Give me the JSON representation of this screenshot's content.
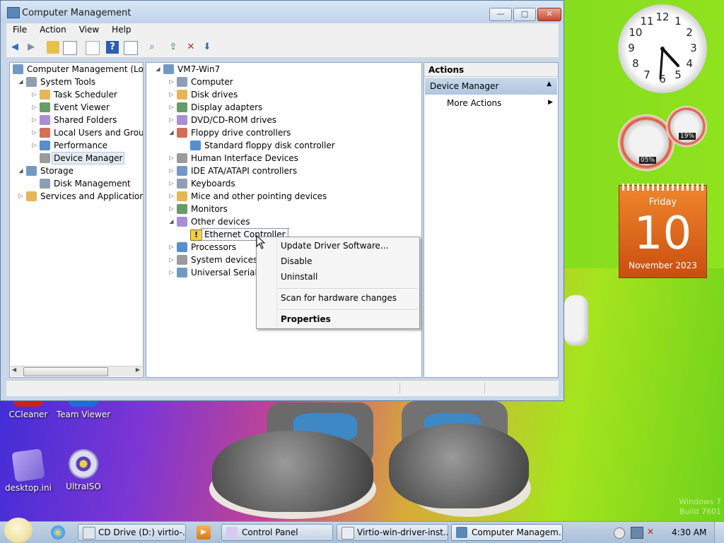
{
  "window": {
    "title": "Computer Management",
    "controls": {
      "minimize": "—",
      "maximize": "□",
      "close": "✕"
    },
    "menu": [
      "File",
      "Action",
      "View",
      "Help"
    ]
  },
  "left_tree": [
    {
      "label": "Computer Management (Local",
      "level": 0,
      "expander": "",
      "icon": "computer-management-icon"
    },
    {
      "label": "System Tools",
      "level": 1,
      "expander": "◢",
      "icon": "system-tools-icon"
    },
    {
      "label": "Task Scheduler",
      "level": 2,
      "expander": "▷",
      "icon": "clock-icon"
    },
    {
      "label": "Event Viewer",
      "level": 2,
      "expander": "▷",
      "icon": "event-viewer-icon"
    },
    {
      "label": "Shared Folders",
      "level": 2,
      "expander": "▷",
      "icon": "shared-folder-icon"
    },
    {
      "label": "Local Users and Groups",
      "level": 2,
      "expander": "▷",
      "icon": "users-icon"
    },
    {
      "label": "Performance",
      "level": 2,
      "expander": "▷",
      "icon": "performance-icon"
    },
    {
      "label": "Device Manager",
      "level": 2,
      "expander": "",
      "icon": "device-manager-icon",
      "selected": true
    },
    {
      "label": "Storage",
      "level": 1,
      "expander": "◢",
      "icon": "storage-icon"
    },
    {
      "label": "Disk Management",
      "level": 2,
      "expander": "",
      "icon": "disk-management-icon"
    },
    {
      "label": "Services and Applications",
      "level": 1,
      "expander": "▷",
      "icon": "services-icon"
    }
  ],
  "device_tree": [
    {
      "label": "VM7-Win7",
      "level": 0,
      "expander": "◢",
      "icon": "computer-icon"
    },
    {
      "label": "Computer",
      "level": 1,
      "expander": "▷",
      "icon": "computer-icon"
    },
    {
      "label": "Disk drives",
      "level": 1,
      "expander": "▷",
      "icon": "disk-drive-icon"
    },
    {
      "label": "Display adapters",
      "level": 1,
      "expander": "▷",
      "icon": "display-adapter-icon"
    },
    {
      "label": "DVD/CD-ROM drives",
      "level": 1,
      "expander": "▷",
      "icon": "dvd-drive-icon"
    },
    {
      "label": "Floppy drive controllers",
      "level": 1,
      "expander": "◢",
      "icon": "floppy-controller-icon"
    },
    {
      "label": "Standard floppy disk controller",
      "level": 2,
      "expander": "",
      "icon": "floppy-controller-icon"
    },
    {
      "label": "Human Interface Devices",
      "level": 1,
      "expander": "▷",
      "icon": "hid-icon"
    },
    {
      "label": "IDE ATA/ATAPI controllers",
      "level": 1,
      "expander": "▷",
      "icon": "ide-controller-icon"
    },
    {
      "label": "Keyboards",
      "level": 1,
      "expander": "▷",
      "icon": "keyboard-icon"
    },
    {
      "label": "Mice and other pointing devices",
      "level": 1,
      "expander": "▷",
      "icon": "mouse-icon"
    },
    {
      "label": "Monitors",
      "level": 1,
      "expander": "▷",
      "icon": "monitor-icon"
    },
    {
      "label": "Other devices",
      "level": 1,
      "expander": "◢",
      "icon": "unknown-device-icon"
    },
    {
      "label": "Ethernet Controller",
      "level": 2,
      "expander": "",
      "icon": "warning-device-icon",
      "focused": true
    },
    {
      "label": "Processors",
      "level": 1,
      "expander": "▷",
      "icon": "processor-icon"
    },
    {
      "label": "System devices",
      "level": 1,
      "expander": "▷",
      "icon": "system-device-icon"
    },
    {
      "label": "Universal Serial Bu",
      "level": 1,
      "expander": "▷",
      "icon": "usb-icon"
    }
  ],
  "actions": {
    "header": "Actions",
    "section": "Device Manager",
    "more": "More Actions"
  },
  "context_menu": {
    "update": "Update Driver Software...",
    "disable": "Disable",
    "uninstall": "Uninstall",
    "scan": "Scan for hardware changes",
    "properties": "Properties"
  },
  "gadgets": {
    "clock_numbers": [
      "12",
      "1",
      "2",
      "3",
      "4",
      "5",
      "6",
      "7",
      "8",
      "9",
      "10",
      "11"
    ],
    "cpu_meter": "05%",
    "memory_meter": "19%",
    "calendar_day": "Friday",
    "calendar_date": "10",
    "calendar_month_year": "November 2023"
  },
  "desktop_icons": {
    "ccleaner": "CCleaner",
    "teamviewer": "Team Viewer",
    "desktop_ini": "desktop.ini",
    "ultraiso": "UltraISO"
  },
  "watermark": {
    "line1": "Windows 7",
    "line2": "Build 7601"
  },
  "taskbar": {
    "tasks": [
      "CD Drive (D:) virtio-...",
      "Control Panel",
      "Virtio-win-driver-inst...",
      "Computer Managem..."
    ],
    "time": "4:30 AM"
  },
  "colors": {
    "titlebar": "#c8d8ea",
    "selection": "#e2eaf3",
    "calendar": "#e2691c",
    "accent": "#5d7fa5"
  }
}
